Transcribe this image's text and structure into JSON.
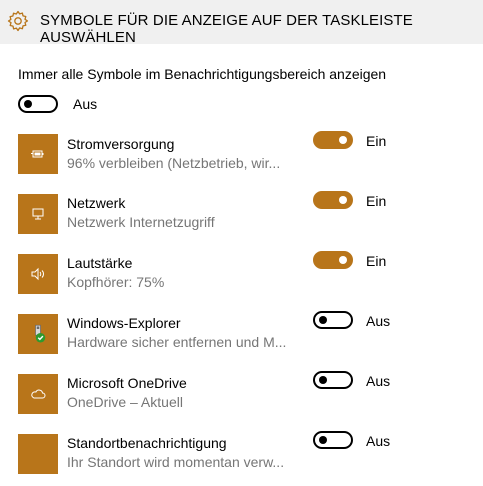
{
  "header": {
    "title": "SYMBOLE FÜR DIE ANZEIGE AUF DER TASKLEISTE AUSWÄHLEN",
    "icon": "gear-icon"
  },
  "master": {
    "label": "Immer alle Symbole im Benachrichtigungsbereich anzeigen",
    "state_label": "Aus",
    "on": false
  },
  "colors": {
    "accent": "#b8751a",
    "header_bg": "#f0f0f0",
    "secondary_text": "#767676"
  },
  "items": [
    {
      "title": "Stromversorgung",
      "subtitle": "96% verbleiben (Netzbetrieb, wir...",
      "state_label": "Ein",
      "on": true,
      "icon": "battery-icon"
    },
    {
      "title": "Netzwerk",
      "subtitle": "Netzwerk Internetzugriff",
      "state_label": "Ein",
      "on": true,
      "icon": "network-icon"
    },
    {
      "title": "Lautstärke",
      "subtitle": "Kopfhörer: 75%",
      "state_label": "Ein",
      "on": true,
      "icon": "speaker-icon"
    },
    {
      "title": "Windows-Explorer",
      "subtitle": "Hardware sicher entfernen und M...",
      "state_label": "Aus",
      "on": false,
      "icon": "usb-safe-remove-icon"
    },
    {
      "title": "Microsoft OneDrive",
      "subtitle": "OneDrive – Aktuell",
      "state_label": "Aus",
      "on": false,
      "icon": "cloud-icon"
    },
    {
      "title": "Standortbenachrichtigung",
      "subtitle": "Ihr Standort wird momentan verw...",
      "state_label": "Aus",
      "on": false,
      "icon": "location-icon"
    }
  ]
}
